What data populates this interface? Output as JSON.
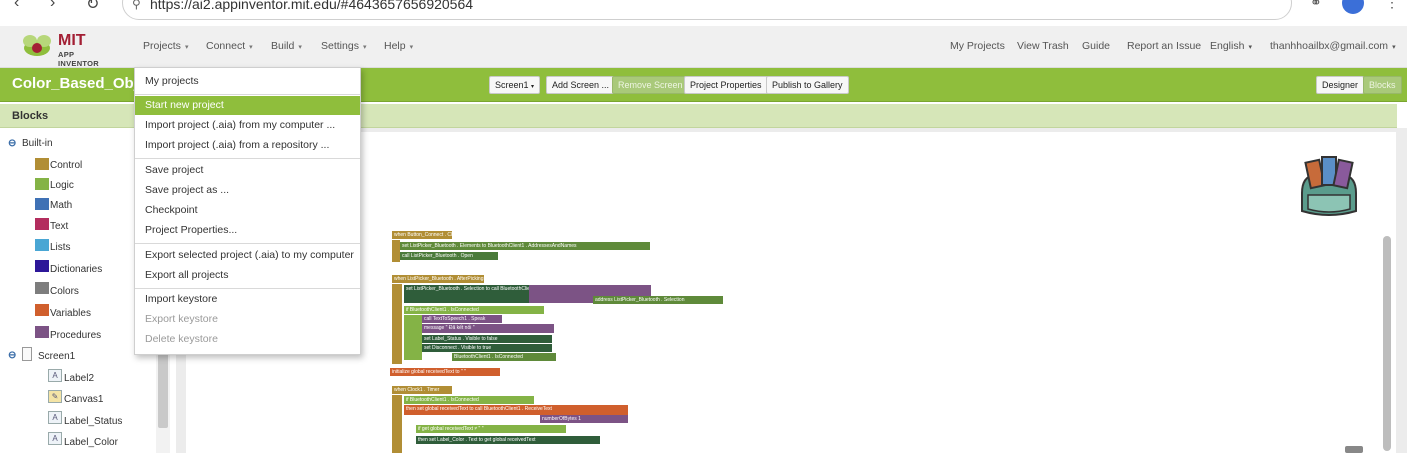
{
  "browser": {
    "url": "https://ai2.appinventor.mit.edu/#4643657656920564"
  },
  "app": {
    "logo_title": "MIT",
    "logo_subtitle": "APP INVENTOR",
    "menus": [
      "Projects",
      "Connect",
      "Build",
      "Settings",
      "Help"
    ],
    "right_links": [
      "My Projects",
      "View Trash",
      "Guide",
      "Report an Issue",
      "English"
    ],
    "user_email": "thanhhoailbx@gmail.com"
  },
  "project": {
    "title": "Color_Based_Object",
    "screen_select": "Screen1",
    "buttons": {
      "add_screen": "Add Screen ...",
      "remove_screen": "Remove Screen",
      "project_properties": "Project Properties",
      "publish": "Publish to Gallery",
      "designer": "Designer",
      "blocks": "Blocks"
    }
  },
  "blocks_panel": {
    "header": "Blocks",
    "builtin_label": "Built-in",
    "builtin": [
      {
        "label": "Control",
        "color": "#b18e35"
      },
      {
        "label": "Logic",
        "color": "#84b346"
      },
      {
        "label": "Math",
        "color": "#3f71b5"
      },
      {
        "label": "Text",
        "color": "#b32d5e"
      },
      {
        "label": "Lists",
        "color": "#49a6d4"
      },
      {
        "label": "Dictionaries",
        "color": "#2d1799"
      },
      {
        "label": "Colors",
        "color": "#7d7d7d"
      },
      {
        "label": "Variables",
        "color": "#d05f2d"
      },
      {
        "label": "Procedures",
        "color": "#7c5385"
      }
    ],
    "screen_label": "Screen1",
    "components": [
      "Label2",
      "Canvas1",
      "Label_Status",
      "Label_Color"
    ]
  },
  "projects_menu": {
    "items": [
      {
        "label": "My projects",
        "state": "normal"
      },
      {
        "label": "Start new project",
        "state": "selected"
      },
      {
        "label": "Import project (.aia) from my computer ...",
        "state": "normal"
      },
      {
        "label": "Import project (.aia) from a repository ...",
        "state": "normal"
      },
      {
        "label": "Save project",
        "state": "normal"
      },
      {
        "label": "Save project as ...",
        "state": "normal"
      },
      {
        "label": "Checkpoint",
        "state": "normal"
      },
      {
        "label": "Project Properties...",
        "state": "normal"
      },
      {
        "label": "Export selected project (.aia) to my computer",
        "state": "normal"
      },
      {
        "label": "Export all projects",
        "state": "normal"
      },
      {
        "label": "Import keystore",
        "state": "normal"
      },
      {
        "label": "Export keystore",
        "state": "disabled"
      },
      {
        "label": "Delete keystore",
        "state": "disabled"
      }
    ]
  },
  "workspace_blocks": {
    "b1": "when Button_Connect . Click",
    "b2": "set ListPicker_Bluetooth . Elements to BluetoothClient1 . AddressesAndNames",
    "b3": "call ListPicker_Bluetooth . Open",
    "b4": "when ListPicker_Bluetooth . AfterPicking",
    "b5": "set ListPicker_Bluetooth . Selection to call BluetoothClient1 . Connect",
    "b6": "address ListPicker_Bluetooth . Selection",
    "b7": "if BluetoothClient1 . IsConnected",
    "b8": "call TextToSpeech1 . Speak",
    "b9": "message \" Đã kết nối \"",
    "b10": "set Label_Status . Visible to false",
    "b11": "set Disconnect . Visible to true",
    "b12": "BluetoothClient1 . IsConnected",
    "b13": "initialize global receivedText to \" \"",
    "b14": "when Clock1 . Timer",
    "b15": "if BluetoothClient1 . IsConnected",
    "b16": "then set global receivedText to call BluetoothClient1 . ReceiveText",
    "b17": "numberOfBytes 1",
    "b18": "if get global receivedText ≠ \" \"",
    "b19": "then set Label_Color . Text to get global receivedText"
  }
}
